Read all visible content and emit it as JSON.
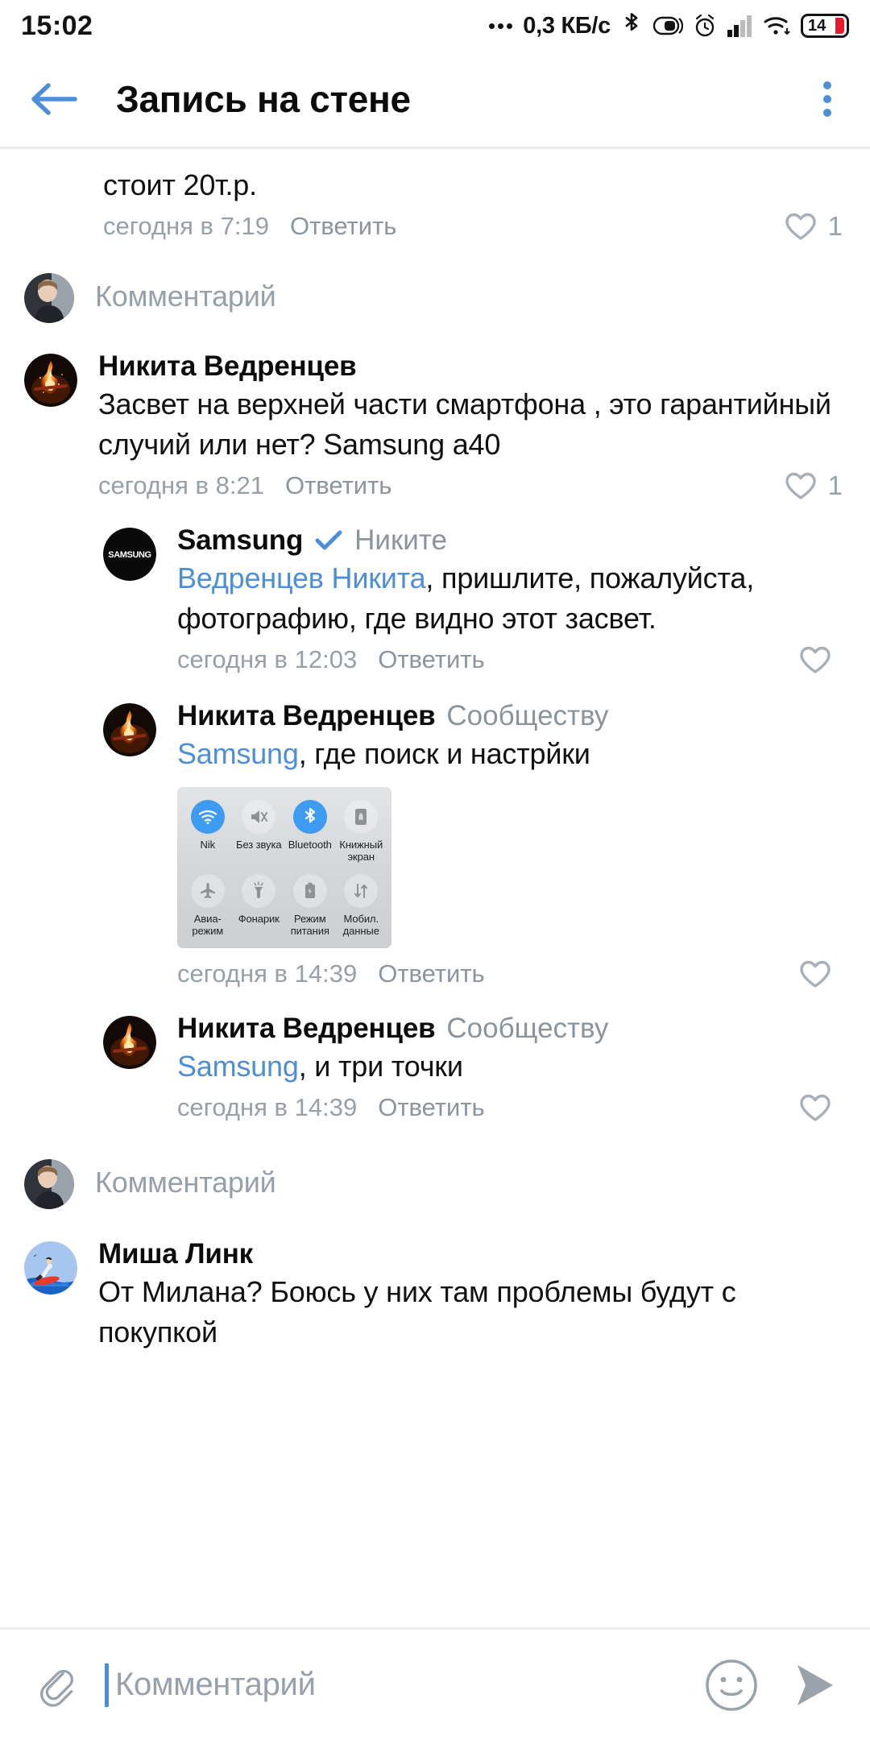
{
  "status_bar": {
    "clock": "15:02",
    "net_speed": "0,3 КБ/с",
    "battery_level": "14",
    "icons": [
      "bluetooth-icon",
      "do-not-disturb-icon",
      "alarm-icon",
      "signal-icon",
      "wifi-icon",
      "battery-icon"
    ]
  },
  "header": {
    "title": "Запись на стене",
    "back_icon": "arrow-left-icon",
    "menu_icon": "kebab-menu-icon",
    "accent_color": "#4c8fd8"
  },
  "comments": [
    {
      "id": "c1",
      "level": 1,
      "truncated_top": true,
      "text": "стоит 20т.р.",
      "time": "сегодня в 7:19",
      "reply_label": "Ответить",
      "likes": "1"
    },
    {
      "id": "ph1",
      "type": "placeholder_row",
      "level": 1,
      "placeholder": "Комментарий",
      "avatar": "user-photo-avatar"
    },
    {
      "id": "c2",
      "level": 1,
      "author": "Никита Ведренцев",
      "avatar": "bonfire-avatar",
      "text": "Засвет на верхней части смартфона , это гарантийный случий или нет? Samsung a40",
      "time": "сегодня в 8:21",
      "reply_label": "Ответить",
      "likes": "1"
    },
    {
      "id": "c3",
      "level": 2,
      "author": "Samsung",
      "verified": true,
      "avatar": "samsung-logo-avatar",
      "reply_to": "Никите",
      "mention": "Ведренцев Никита",
      "text": ", пришлите, пожалуйста, фотографию, где видно этот засвет.",
      "time": "сегодня в 12:03",
      "reply_label": "Ответить",
      "likes": ""
    },
    {
      "id": "c4",
      "level": 2,
      "author": "Никита Ведренцев",
      "avatar": "bonfire-avatar",
      "reply_to": "Сообществу",
      "mention": "Samsung",
      "text": ", где поиск и настрйки",
      "time": "сегодня в 14:39",
      "reply_label": "Ответить",
      "likes": "",
      "attachment": "quick-settings-screenshot"
    },
    {
      "id": "c5",
      "level": 2,
      "author": "Никита Ведренцев",
      "avatar": "bonfire-avatar",
      "reply_to": "Сообществу",
      "mention": "Samsung",
      "text": ", и три точки",
      "time": "сегодня в 14:39",
      "reply_label": "Ответить",
      "likes": ""
    },
    {
      "id": "ph2",
      "type": "placeholder_row",
      "level": 2,
      "placeholder": "Комментарий",
      "avatar": "user-photo-avatar"
    },
    {
      "id": "c6",
      "level": 1,
      "author": "Миша Линк",
      "avatar": "surfer-avatar",
      "text": "От Милана? Боюсь у них там проблемы будут с покупкой"
    }
  ],
  "attachment_quick_settings": {
    "tiles": [
      {
        "label": "Nik",
        "icon": "wifi-icon",
        "active": true
      },
      {
        "label": "Без звука",
        "icon": "mute-icon",
        "active": false
      },
      {
        "label": "Bluetooth",
        "icon": "bluetooth-icon",
        "active": true
      },
      {
        "label": "Книжный экран",
        "icon": "screen-rotation-lock-icon",
        "active": false
      },
      {
        "label": "Авиа-режим",
        "icon": "airplane-icon",
        "active": false
      },
      {
        "label": "Фонарик",
        "icon": "flashlight-icon",
        "active": false
      },
      {
        "label": "Режим питания",
        "icon": "battery-saver-icon",
        "active": false
      },
      {
        "label": "Мобил. данные",
        "icon": "data-transfer-icon",
        "active": false
      }
    ],
    "active_color": "#3d9bf2"
  },
  "compose_bar": {
    "attach_icon": "paperclip-icon",
    "placeholder": "Комментарий",
    "emoji_icon": "smiley-icon",
    "send_icon": "send-arrow-icon"
  }
}
